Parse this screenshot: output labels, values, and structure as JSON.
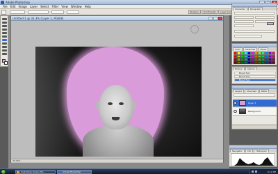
{
  "app": {
    "title": "Adobe Photoshop",
    "window_controls": [
      "_",
      "□",
      "×"
    ]
  },
  "menubar": {
    "items": [
      "File",
      "Edit",
      "Image",
      "Layer",
      "Select",
      "Filter",
      "View",
      "Window",
      "Help"
    ]
  },
  "document": {
    "title": "Untitled-1 @ 33.3% (Layer 1, RGB/8)",
    "status": "33.33%",
    "brush_color": "#d99bd9"
  },
  "options_tabs": [
    "Brushes",
    "Tool Presets",
    "Layer Comps"
  ],
  "palettes": {
    "character_tabs": [
      "Character",
      "Paragraph"
    ],
    "swatch_tabs": [
      "Color",
      "Swatches",
      "Styles"
    ],
    "history_tabs": [
      "History",
      "Actions"
    ],
    "history_items": [
      "Brush Tool",
      "Brush Tool",
      "Brush Tool"
    ],
    "layers_tabs": [
      "Layers",
      "Channels",
      "Paths"
    ],
    "layers": [
      {
        "name": "Layer 1",
        "selected": true
      },
      {
        "name": "Background",
        "selected": false
      }
    ],
    "histogram_tabs": [
      "Navigator",
      "Info",
      "Histogram"
    ]
  },
  "taskbar": {
    "buttons": [
      {
        "label": "Customize Screen Mo...",
        "active": false
      },
      {
        "label": "Adobe Photoshop",
        "active": true
      }
    ],
    "clock": "8:12 PM"
  }
}
